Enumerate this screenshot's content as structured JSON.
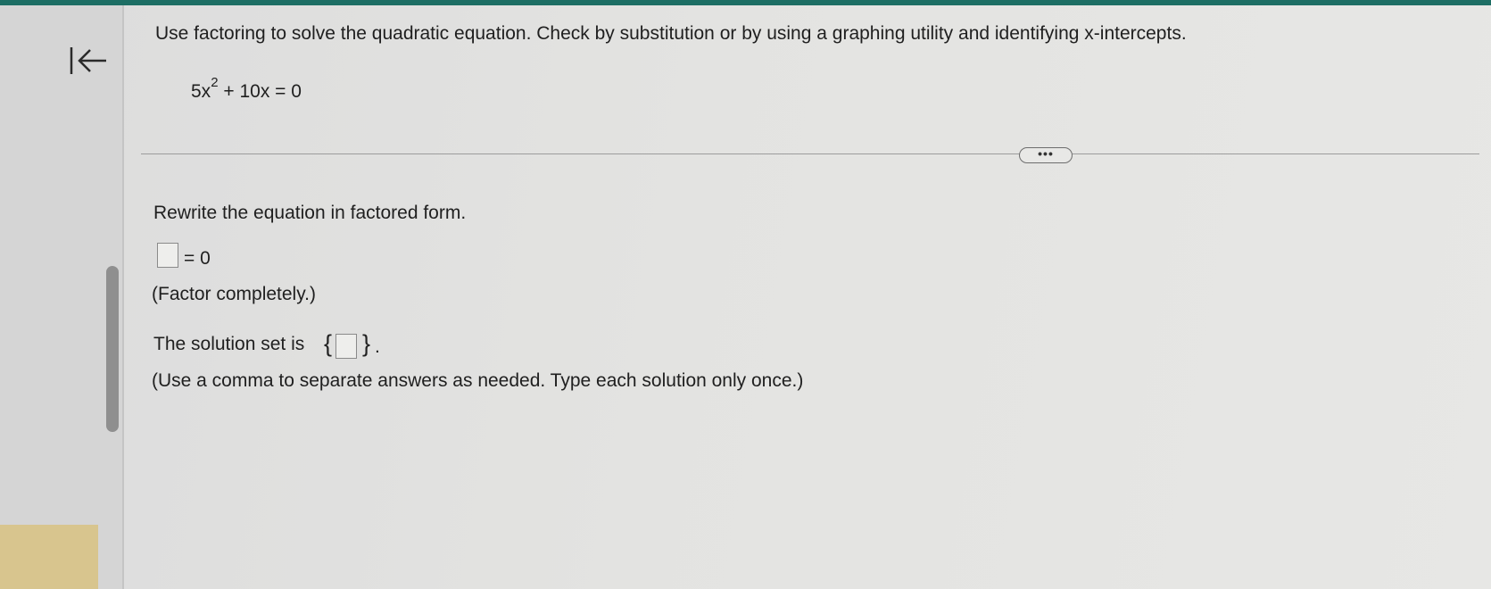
{
  "question": {
    "instruction": "Use factoring to solve the quadratic equation. Check by substitution or by using a graphing utility and identifying x-intercepts.",
    "equation": {
      "coef_a": "5x",
      "exponent": "2",
      "rest": "+ 10x = 0"
    }
  },
  "divider": {
    "more_label": "•••"
  },
  "part1": {
    "prompt": "Rewrite the equation in factored form.",
    "equals_zero": "= 0",
    "hint": "(Factor completely.)"
  },
  "part2": {
    "prompt": "The solution set is",
    "open_brace": "{",
    "close_brace": "}",
    "period": ".",
    "hint": "(Use a comma to separate answers as needed. Type each solution only once.)"
  },
  "icons": {
    "collapse": "collapse-left-icon"
  }
}
